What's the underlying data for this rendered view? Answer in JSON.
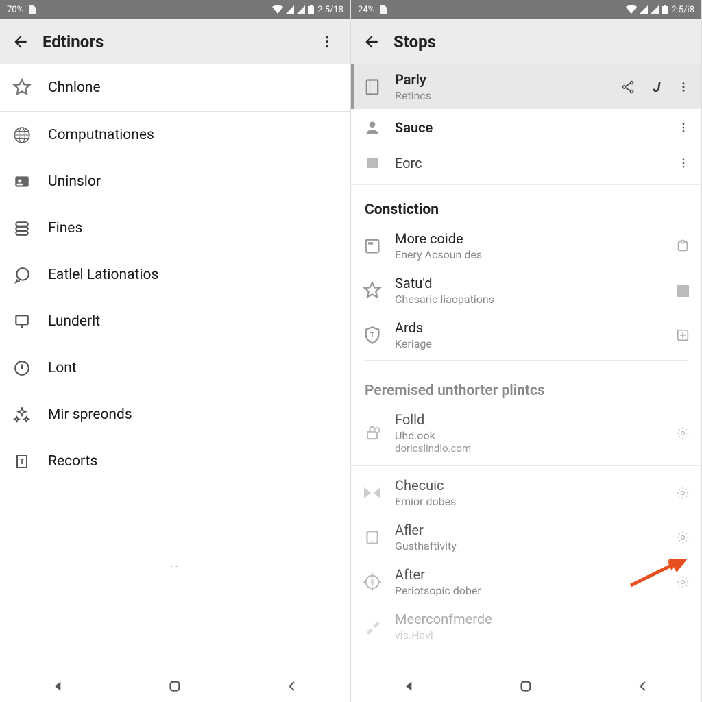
{
  "left": {
    "status": {
      "batteryText": "70%",
      "clock": "2:5/18"
    },
    "title": "Edtinors",
    "items": [
      {
        "icon": "star-icon",
        "label": "Chnlone"
      },
      {
        "icon": "globe-icon",
        "label": "Computnationes"
      },
      {
        "icon": "badge-icon",
        "label": "Uninslor"
      },
      {
        "icon": "stack-icon",
        "label": "Fines"
      },
      {
        "icon": "chat-icon",
        "label": "Eatlel Lationatios"
      },
      {
        "icon": "present-icon",
        "label": "Lunderlt"
      },
      {
        "icon": "clock-icon",
        "label": "Lont"
      },
      {
        "icon": "sparkle-icon",
        "label": "Mir spreonds"
      },
      {
        "icon": "doc-icon",
        "label": "Recorts"
      }
    ]
  },
  "right": {
    "status": {
      "batteryText": "24%",
      "clock": "2:5/i8"
    },
    "title": "Stops",
    "primary": [
      {
        "icon": "book-icon",
        "title": "Parly",
        "sub": "Retincs",
        "actions": [
          "share-icon",
          "j-icon",
          "more-vert-icon"
        ],
        "selected": true
      },
      {
        "icon": "person-icon",
        "title": "Sauce",
        "sub": "",
        "actions": [
          "more-vert-icon"
        ],
        "selected": false
      },
      {
        "icon": "square-icon",
        "title": "Eorc",
        "sub": "",
        "light": true,
        "actions": [
          "more-vert-icon"
        ],
        "selected": false
      }
    ],
    "section1": {
      "heading": "Constiction",
      "items": [
        {
          "icon": "card-icon",
          "title": "More coide",
          "sub": "Enery Acsoun des",
          "trail": "puzzle-icon"
        },
        {
          "icon": "star-icon",
          "title": "Satu'd",
          "sub": "Chesaric liaopations",
          "trail": "square-solid-icon"
        },
        {
          "icon": "shield-icon",
          "title": "Ards",
          "sub": "Keriage",
          "trail": "plus-box-icon"
        }
      ]
    },
    "section2": {
      "heading": "Peremised unthorter plintcs",
      "items": [
        {
          "icon": "lock-icon",
          "title": "Folld",
          "sub": "Uhd.ook",
          "ter": "doricslindlo.com",
          "trail": "gear-icon"
        },
        {
          "icon": "bowtie-icon",
          "title": "Checuic",
          "sub": "Emior dobes",
          "trail": "gear-icon"
        },
        {
          "icon": "tablet-icon",
          "title": "Afler",
          "sub": "Gusthaftivity",
          "trail": "gear-icon"
        },
        {
          "icon": "compass-icon",
          "title": "After",
          "sub": "Periotsopic dober",
          "trail": "gear-icon"
        },
        {
          "icon": "brush-icon",
          "title": "Meerconfmerde",
          "sub": "vis.Havl",
          "trail": "gear-icon"
        }
      ]
    }
  },
  "arrowColor": "#e8501f"
}
